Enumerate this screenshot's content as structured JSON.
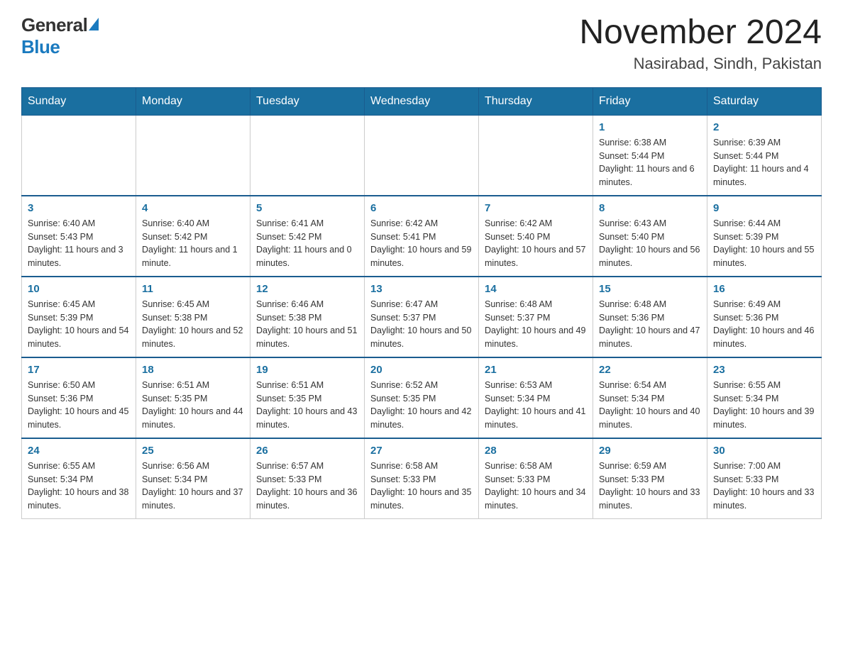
{
  "header": {
    "logo_general": "General",
    "logo_blue": "Blue",
    "month_title": "November 2024",
    "location": "Nasirabad, Sindh, Pakistan"
  },
  "weekdays": [
    "Sunday",
    "Monday",
    "Tuesday",
    "Wednesday",
    "Thursday",
    "Friday",
    "Saturday"
  ],
  "rows": [
    [
      {
        "day": "",
        "info": ""
      },
      {
        "day": "",
        "info": ""
      },
      {
        "day": "",
        "info": ""
      },
      {
        "day": "",
        "info": ""
      },
      {
        "day": "",
        "info": ""
      },
      {
        "day": "1",
        "info": "Sunrise: 6:38 AM\nSunset: 5:44 PM\nDaylight: 11 hours and 6 minutes."
      },
      {
        "day": "2",
        "info": "Sunrise: 6:39 AM\nSunset: 5:44 PM\nDaylight: 11 hours and 4 minutes."
      }
    ],
    [
      {
        "day": "3",
        "info": "Sunrise: 6:40 AM\nSunset: 5:43 PM\nDaylight: 11 hours and 3 minutes."
      },
      {
        "day": "4",
        "info": "Sunrise: 6:40 AM\nSunset: 5:42 PM\nDaylight: 11 hours and 1 minute."
      },
      {
        "day": "5",
        "info": "Sunrise: 6:41 AM\nSunset: 5:42 PM\nDaylight: 11 hours and 0 minutes."
      },
      {
        "day": "6",
        "info": "Sunrise: 6:42 AM\nSunset: 5:41 PM\nDaylight: 10 hours and 59 minutes."
      },
      {
        "day": "7",
        "info": "Sunrise: 6:42 AM\nSunset: 5:40 PM\nDaylight: 10 hours and 57 minutes."
      },
      {
        "day": "8",
        "info": "Sunrise: 6:43 AM\nSunset: 5:40 PM\nDaylight: 10 hours and 56 minutes."
      },
      {
        "day": "9",
        "info": "Sunrise: 6:44 AM\nSunset: 5:39 PM\nDaylight: 10 hours and 55 minutes."
      }
    ],
    [
      {
        "day": "10",
        "info": "Sunrise: 6:45 AM\nSunset: 5:39 PM\nDaylight: 10 hours and 54 minutes."
      },
      {
        "day": "11",
        "info": "Sunrise: 6:45 AM\nSunset: 5:38 PM\nDaylight: 10 hours and 52 minutes."
      },
      {
        "day": "12",
        "info": "Sunrise: 6:46 AM\nSunset: 5:38 PM\nDaylight: 10 hours and 51 minutes."
      },
      {
        "day": "13",
        "info": "Sunrise: 6:47 AM\nSunset: 5:37 PM\nDaylight: 10 hours and 50 minutes."
      },
      {
        "day": "14",
        "info": "Sunrise: 6:48 AM\nSunset: 5:37 PM\nDaylight: 10 hours and 49 minutes."
      },
      {
        "day": "15",
        "info": "Sunrise: 6:48 AM\nSunset: 5:36 PM\nDaylight: 10 hours and 47 minutes."
      },
      {
        "day": "16",
        "info": "Sunrise: 6:49 AM\nSunset: 5:36 PM\nDaylight: 10 hours and 46 minutes."
      }
    ],
    [
      {
        "day": "17",
        "info": "Sunrise: 6:50 AM\nSunset: 5:36 PM\nDaylight: 10 hours and 45 minutes."
      },
      {
        "day": "18",
        "info": "Sunrise: 6:51 AM\nSunset: 5:35 PM\nDaylight: 10 hours and 44 minutes."
      },
      {
        "day": "19",
        "info": "Sunrise: 6:51 AM\nSunset: 5:35 PM\nDaylight: 10 hours and 43 minutes."
      },
      {
        "day": "20",
        "info": "Sunrise: 6:52 AM\nSunset: 5:35 PM\nDaylight: 10 hours and 42 minutes."
      },
      {
        "day": "21",
        "info": "Sunrise: 6:53 AM\nSunset: 5:34 PM\nDaylight: 10 hours and 41 minutes."
      },
      {
        "day": "22",
        "info": "Sunrise: 6:54 AM\nSunset: 5:34 PM\nDaylight: 10 hours and 40 minutes."
      },
      {
        "day": "23",
        "info": "Sunrise: 6:55 AM\nSunset: 5:34 PM\nDaylight: 10 hours and 39 minutes."
      }
    ],
    [
      {
        "day": "24",
        "info": "Sunrise: 6:55 AM\nSunset: 5:34 PM\nDaylight: 10 hours and 38 minutes."
      },
      {
        "day": "25",
        "info": "Sunrise: 6:56 AM\nSunset: 5:34 PM\nDaylight: 10 hours and 37 minutes."
      },
      {
        "day": "26",
        "info": "Sunrise: 6:57 AM\nSunset: 5:33 PM\nDaylight: 10 hours and 36 minutes."
      },
      {
        "day": "27",
        "info": "Sunrise: 6:58 AM\nSunset: 5:33 PM\nDaylight: 10 hours and 35 minutes."
      },
      {
        "day": "28",
        "info": "Sunrise: 6:58 AM\nSunset: 5:33 PM\nDaylight: 10 hours and 34 minutes."
      },
      {
        "day": "29",
        "info": "Sunrise: 6:59 AM\nSunset: 5:33 PM\nDaylight: 10 hours and 33 minutes."
      },
      {
        "day": "30",
        "info": "Sunrise: 7:00 AM\nSunset: 5:33 PM\nDaylight: 10 hours and 33 minutes."
      }
    ]
  ]
}
